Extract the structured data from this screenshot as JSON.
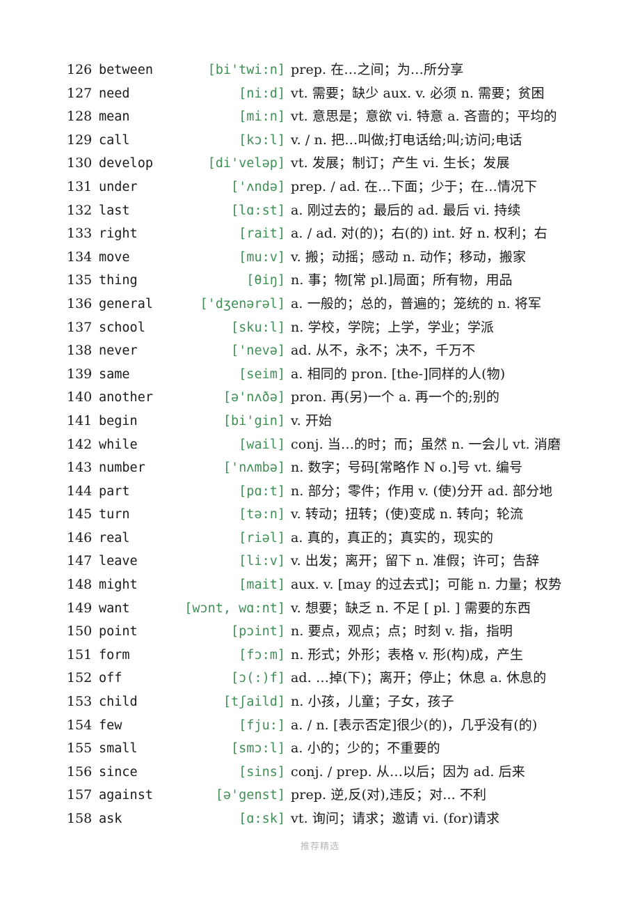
{
  "document": {
    "watermark": "推荐精选",
    "phonetic_color": "#3f8f55",
    "text_color": "#1a1a1a"
  },
  "entries": [
    {
      "index": "126",
      "word": "between",
      "phonetic": "[bi'twi:n]",
      "definition": "prep. 在…之间；为…所分享"
    },
    {
      "index": "127",
      "word": "need",
      "phonetic": "[ni:d]",
      "definition": "vt. 需要；缺少 aux. v. 必须 n. 需要；贫困"
    },
    {
      "index": "128",
      "word": "mean",
      "phonetic": "[mi:n]",
      "definition": "vt. 意思是；意欲 vi. 特意 a. 吝啬的；平均的"
    },
    {
      "index": "129",
      "word": "call",
      "phonetic": "[kɔ:l]",
      "definition": "v. / n. 把…叫做;打电话给;叫;访问;电话"
    },
    {
      "index": "130",
      "word": "develop",
      "phonetic": "[di'veləp]",
      "definition": "vt. 发展；制订；产生 vi. 生长；发展"
    },
    {
      "index": "131",
      "word": "under",
      "phonetic": "['ʌndə]",
      "definition": "prep. / ad. 在…下面；少于；在…情况下"
    },
    {
      "index": "132",
      "word": "last",
      "phonetic": "[lɑ:st]",
      "definition": "a. 刚过去的；最后的 ad. 最后 vi. 持续"
    },
    {
      "index": "133",
      "word": "right",
      "phonetic": "[rait]",
      "definition": "a. / ad. 对(的)；右(的) int. 好 n. 权利；右"
    },
    {
      "index": "134",
      "word": "move",
      "phonetic": "[mu:v]",
      "definition": "v. 搬；动摇；感动 n. 动作；移动，搬家"
    },
    {
      "index": "135",
      "word": "thing",
      "phonetic": "[θiŋ]",
      "definition": "n. 事；物[常 pl.]局面；所有物，用品"
    },
    {
      "index": "136",
      "word": "general",
      "phonetic": "['dʒenərəl]",
      "definition": "a. 一般的；总的，普遍的；笼统的 n. 将军"
    },
    {
      "index": "137",
      "word": "school",
      "phonetic": "[sku:l]",
      "definition": "n. 学校，学院；上学，学业；学派"
    },
    {
      "index": "138",
      "word": "never",
      "phonetic": "['nevə]",
      "definition": "ad. 从不，永不；决不，千万不"
    },
    {
      "index": "139",
      "word": "same",
      "phonetic": "[seim]",
      "definition": "a. 相同的 pron. [the-]同样的人(物)"
    },
    {
      "index": "140",
      "word": "another",
      "phonetic": "[ə'nʌðə]",
      "definition": "pron. 再(另)一个 a. 再一个的;别的"
    },
    {
      "index": "141",
      "word": "begin",
      "phonetic": "[bi'gin]",
      "definition": "v. 开始"
    },
    {
      "index": "142",
      "word": "while",
      "phonetic": "[wail]",
      "definition": "conj. 当…的时；而；虽然 n. 一会儿 vt. 消磨"
    },
    {
      "index": "143",
      "word": "number",
      "phonetic": "['nʌmbə]",
      "definition": "n. 数字；号码[常略作 N o.]号 vt. 编号"
    },
    {
      "index": "144",
      "word": "part",
      "phonetic": "[pɑ:t]",
      "definition": "n. 部分；零件；作用 v. (使)分开 ad. 部分地"
    },
    {
      "index": "145",
      "word": "turn",
      "phonetic": "[tə:n]",
      "definition": "v. 转动；扭转；(使)变成 n. 转向；轮流"
    },
    {
      "index": "146",
      "word": "real",
      "phonetic": "[riəl]",
      "definition": "a. 真的，真正的；真实的，现实的"
    },
    {
      "index": "147",
      "word": "leave",
      "phonetic": "[li:v]",
      "definition": "v. 出发；离开；留下 n. 准假；许可；告辞"
    },
    {
      "index": "148",
      "word": "might",
      "phonetic": "[mait]",
      "definition": "aux. v. [may 的过去式]；可能 n. 力量；权势"
    },
    {
      "index": "149",
      "word": "want",
      "phonetic": "[wɔnt, wɑ:nt]",
      "definition": "v. 想要；缺乏 n. 不足 [ pl. ] 需要的东西"
    },
    {
      "index": "150",
      "word": "point",
      "phonetic": "[pɔint]",
      "definition": "n. 要点，观点；点；时刻 v. 指，指明"
    },
    {
      "index": "151",
      "word": "form",
      "phonetic": "[fɔ:m]",
      "definition": "n. 形式；外形；表格 v. 形(构)成，产生"
    },
    {
      "index": "152",
      "word": "off",
      "phonetic": "[ɔ(:)f]",
      "definition": "ad. …掉(下)；离开；停止；休息 a. 休息的"
    },
    {
      "index": "153",
      "word": "child",
      "phonetic": "[tʃaild]",
      "definition": "n. 小孩，儿童；子女，孩子"
    },
    {
      "index": "154",
      "word": "few",
      "phonetic": "[fju:]",
      "definition": "a. / n. [表示否定]很少(的)，几乎没有(的)"
    },
    {
      "index": "155",
      "word": "small",
      "phonetic": "[smɔ:l]",
      "definition": "a. 小的；少的；不重要的"
    },
    {
      "index": "156",
      "word": "since",
      "phonetic": "[sins]",
      "definition": "conj. / prep. 从…以后；因为 ad. 后来"
    },
    {
      "index": "157",
      "word": "against",
      "phonetic": "[ə'genst]",
      "definition": "prep. 逆,反(对),违反；对... 不利"
    },
    {
      "index": "158",
      "word": "ask",
      "phonetic": "[ɑ:sk]",
      "definition": "vt. 询问；请求；邀请 vi. (for)请求"
    }
  ]
}
